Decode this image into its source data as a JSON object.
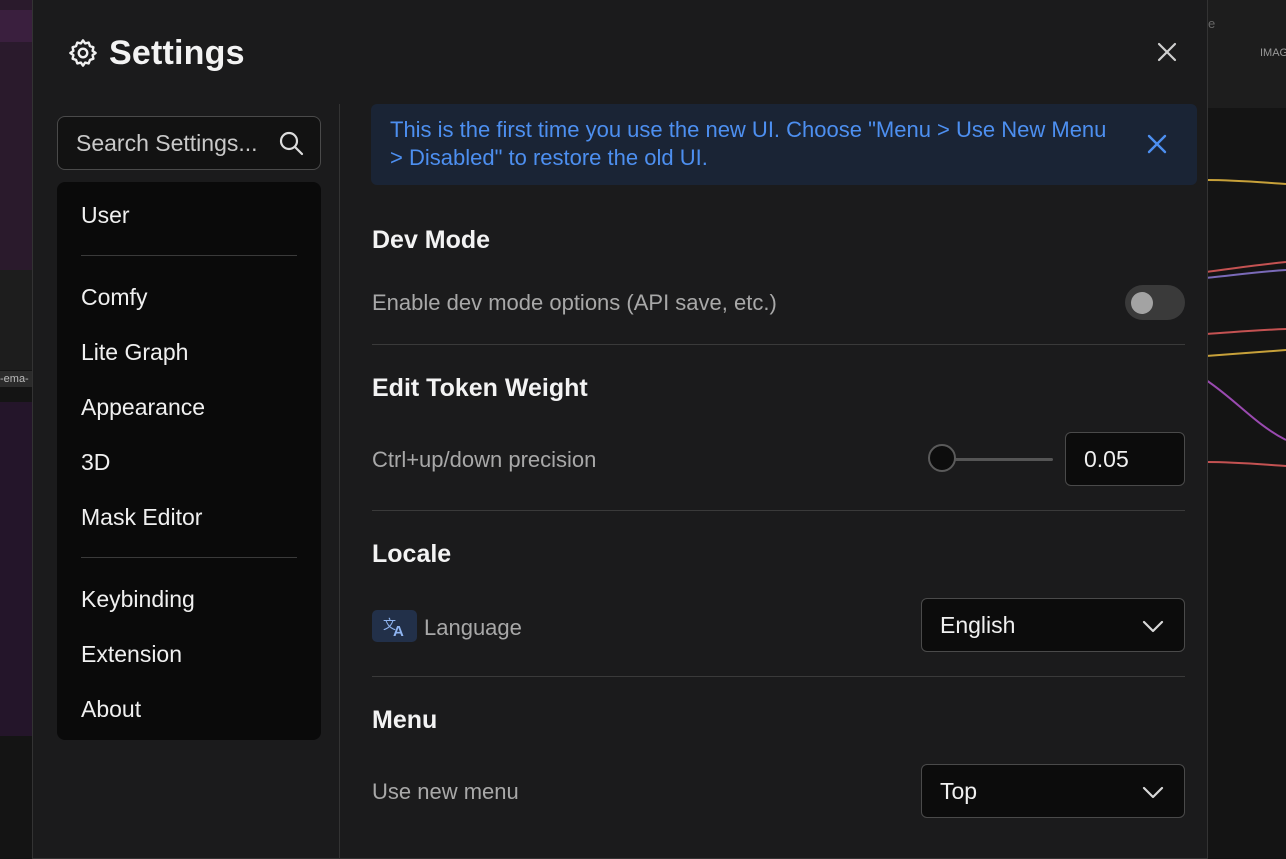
{
  "background": {
    "left_tag": "-ema-",
    "right_label": "IMAG",
    "right_letter": "e"
  },
  "dialog": {
    "title": "Settings",
    "title_icon": "gear-icon",
    "close_icon": "close-icon"
  },
  "search": {
    "placeholder": "Search Settings...",
    "value": "",
    "icon": "search-icon"
  },
  "sidebar": {
    "groups": [
      [
        "User"
      ],
      [
        "Comfy",
        "Lite Graph",
        "Appearance",
        "3D",
        "Mask Editor"
      ],
      [
        "Keybinding",
        "Extension",
        "About"
      ]
    ],
    "items": [
      "User",
      "Comfy",
      "Lite Graph",
      "Appearance",
      "3D",
      "Mask Editor",
      "Keybinding",
      "Extension",
      "About"
    ]
  },
  "banner": {
    "message": "This is the first time you use the new UI. Choose \"Menu > Use New Menu > Disabled\" to restore the old UI.",
    "close_icon": "close-icon",
    "color": "#4d8ff0"
  },
  "sections": {
    "dev_mode": {
      "title": "Dev Mode",
      "setting_label": "Enable dev mode options (API save, etc.)",
      "enabled": false
    },
    "edit_token_weight": {
      "title": "Edit Token Weight",
      "setting_label": "Ctrl+up/down precision",
      "value": "0.05",
      "slider_fraction": 0
    },
    "locale": {
      "title": "Locale",
      "setting_label": "Language",
      "icon": "translate-icon",
      "selected": "English"
    },
    "menu": {
      "title": "Menu",
      "setting_label": "Use new menu",
      "selected": "Top"
    }
  }
}
